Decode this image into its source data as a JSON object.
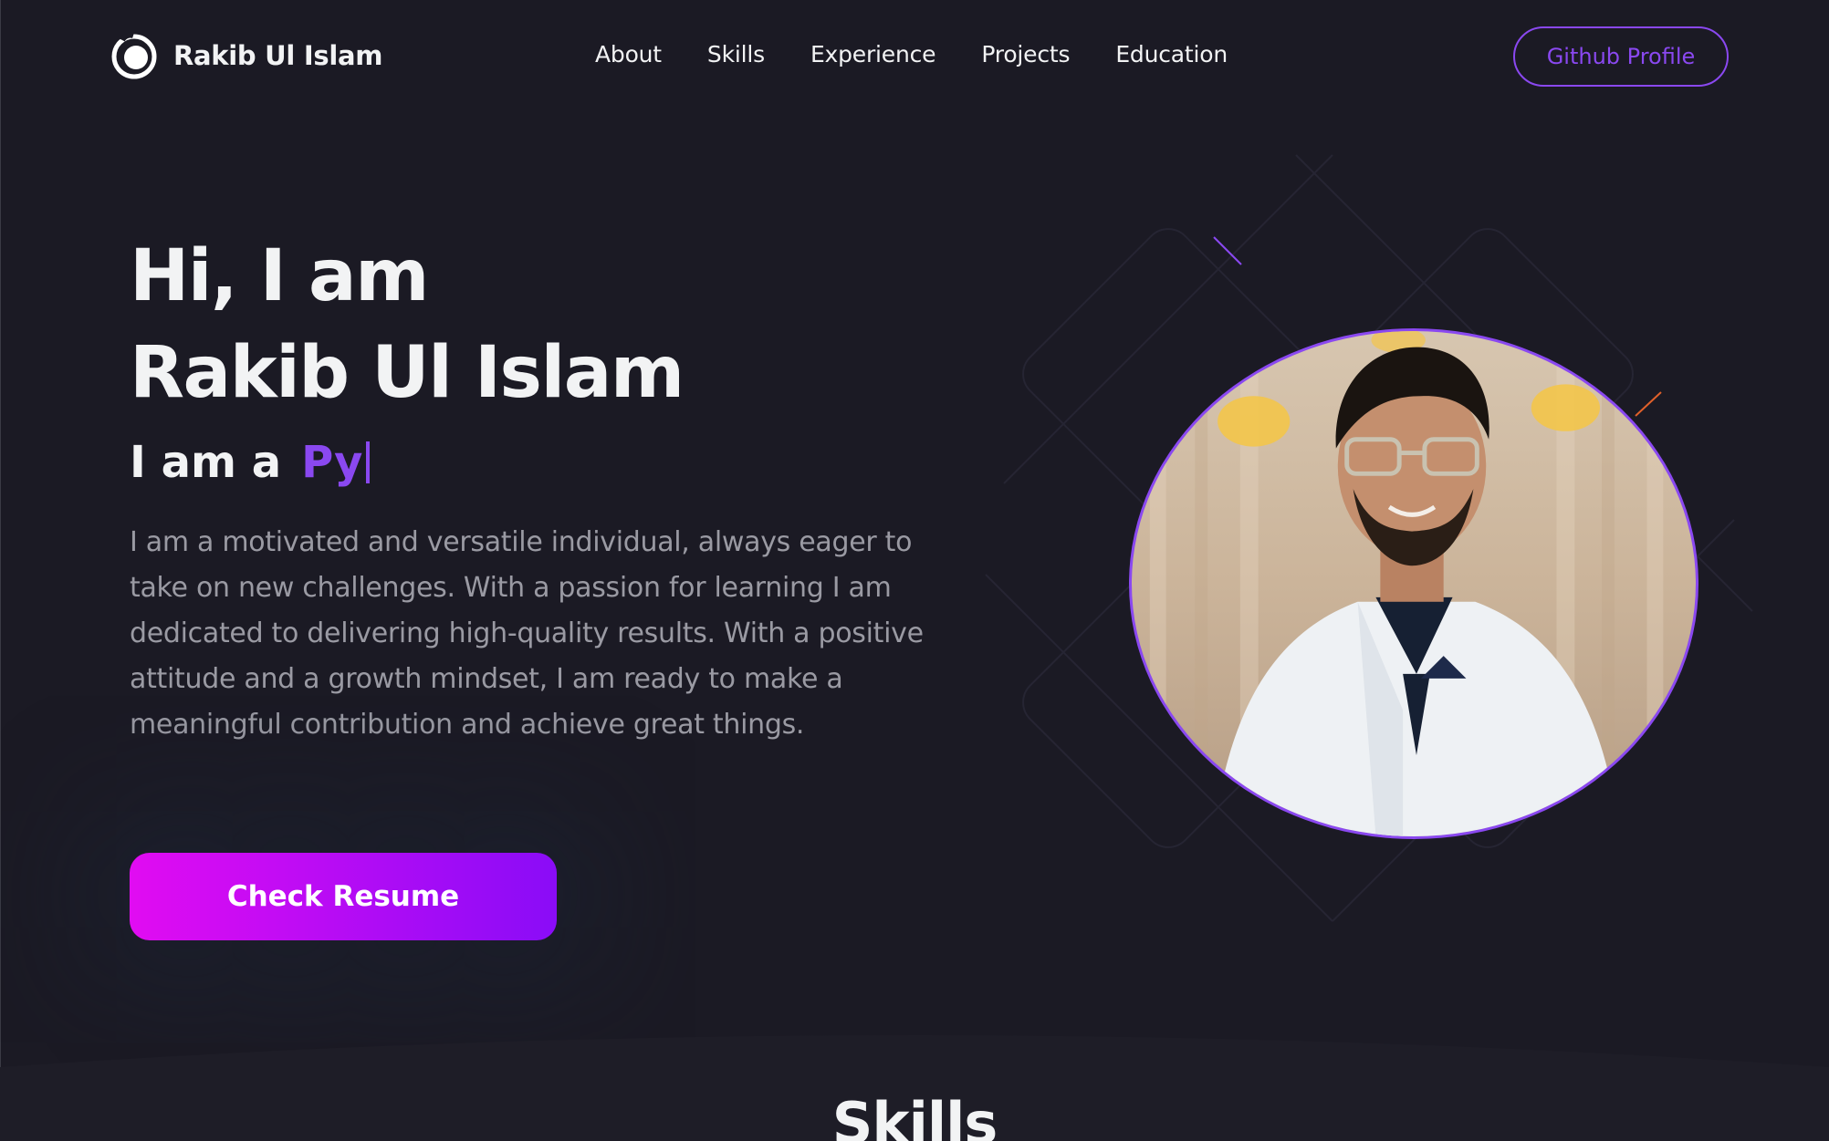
{
  "brand": {
    "name": "Rakib Ul Islam",
    "icon": "logo-circle-icon"
  },
  "nav": {
    "links": [
      {
        "label": "About"
      },
      {
        "label": "Skills"
      },
      {
        "label": "Experience"
      },
      {
        "label": "Projects"
      },
      {
        "label": "Education"
      }
    ],
    "github_label": "Github Profile"
  },
  "hero": {
    "greeting": "Hi, I am",
    "name": "Rakib Ul Islam",
    "role_prefix": "I am a",
    "role_typed": "Py",
    "description": "I am a motivated and versatile individual, always eager to take on new challenges. With a passion for learning I am dedicated to delivering high-quality results. With a positive attitude and a growth mindset, I am ready to make a meaningful contribution and achieve great things.",
    "resume_label": "Check Resume"
  },
  "skills": {
    "title": "Skills"
  },
  "colors": {
    "background": "#1b1a24",
    "accent": "#8a48f0",
    "button_gradient_start": "#e10cf2",
    "button_gradient_end": "#8a0cf7",
    "muted_text": "#9a9aa3"
  }
}
